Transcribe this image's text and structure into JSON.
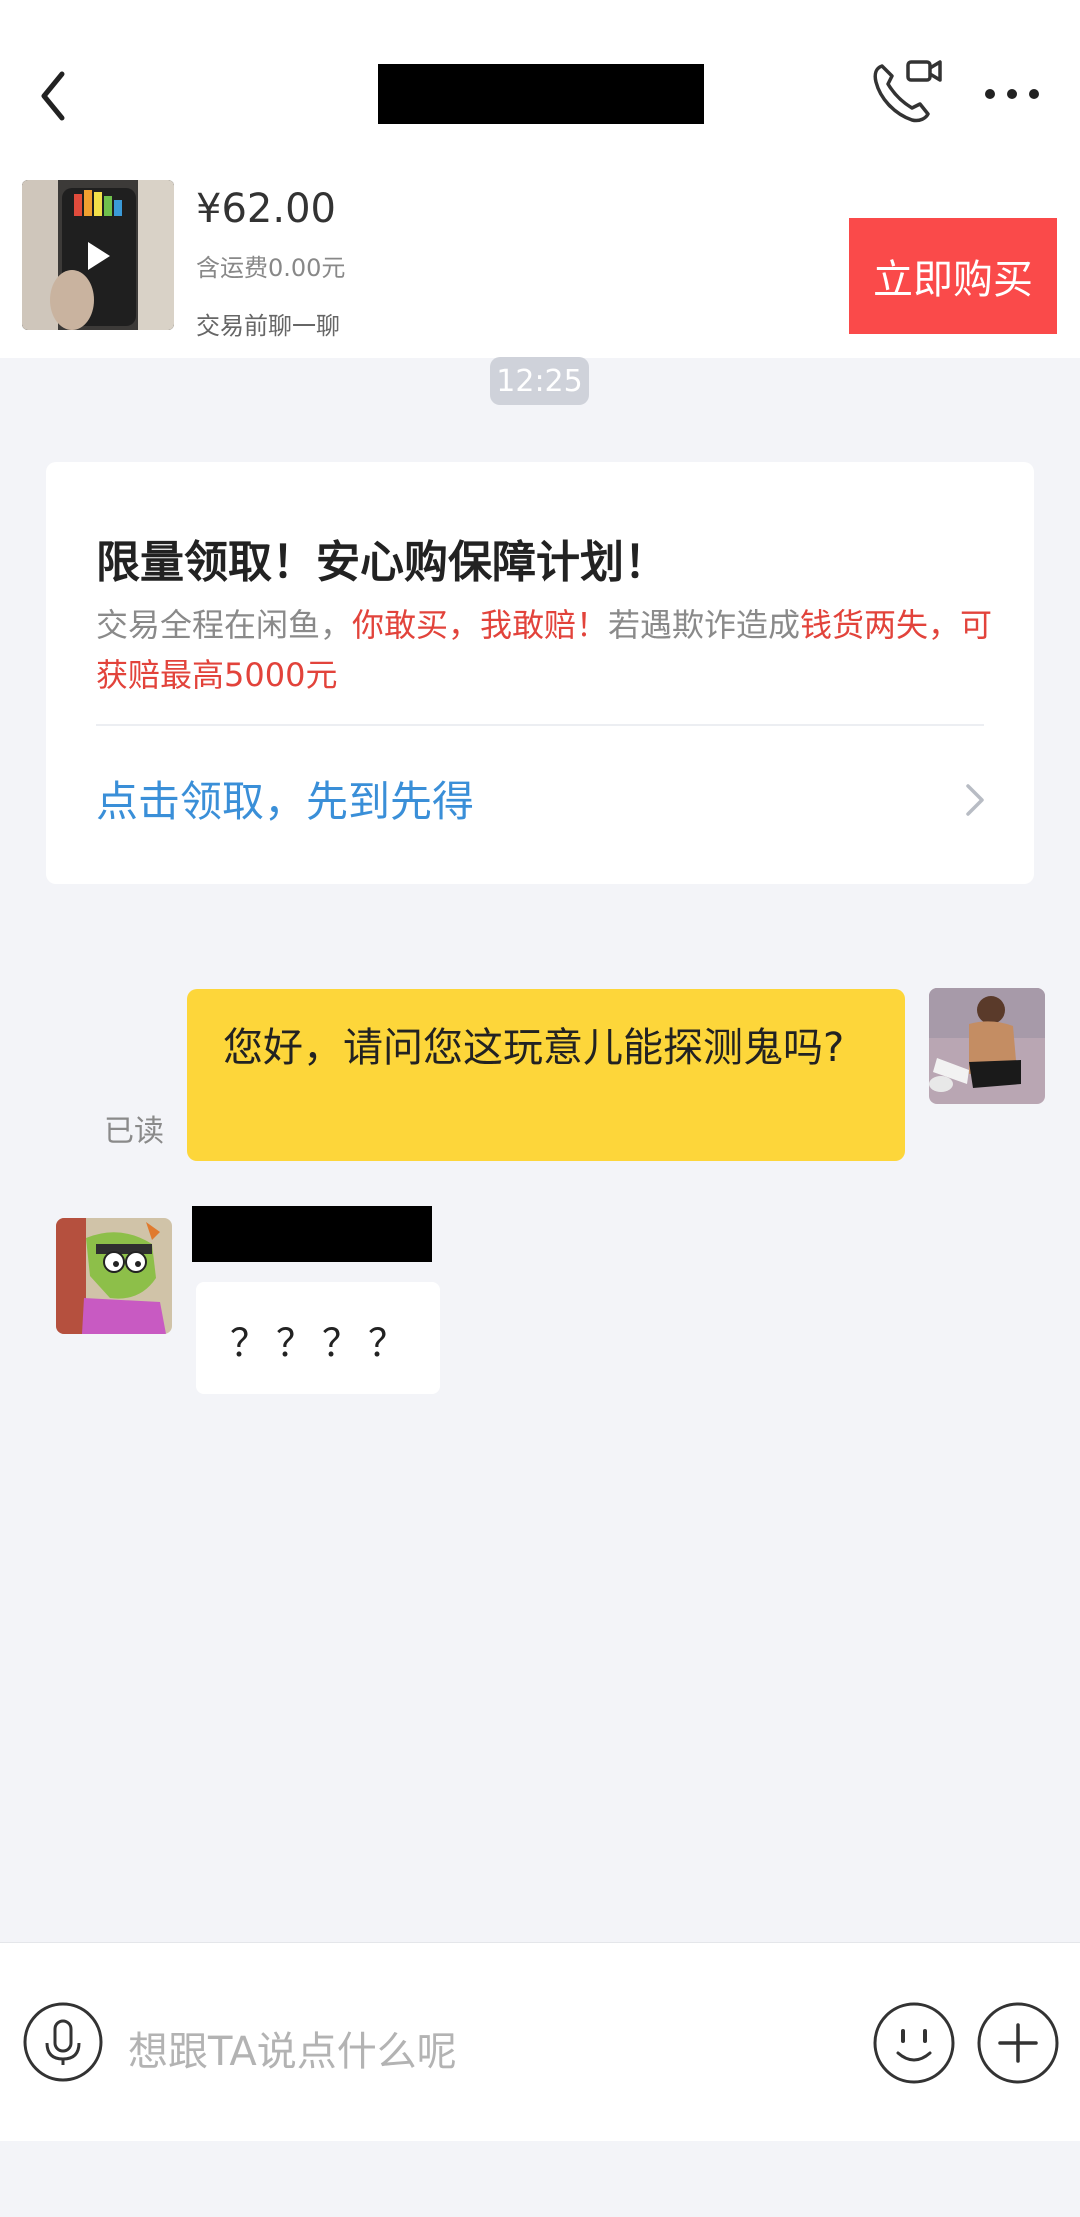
{
  "header": {
    "back_icon": "chevron-left-icon",
    "title_redacted": "",
    "call_icon": "phone-video-icon",
    "more_icon": "more-horizontal-icon"
  },
  "product": {
    "price": "¥62.00",
    "shipping": "含运费0.00元",
    "chat_note": "交易前聊一聊",
    "buy_label": "立即购买",
    "buy_color": "#fa4a4a"
  },
  "chat": {
    "time": "12:25",
    "card": {
      "title": "限量领取！安心购保障计划！",
      "body_part1": "交易全程在闲鱼，",
      "body_part2_red": "你敢买，我敢赔！",
      "body_part3": "若遇欺诈造成",
      "body_part4_red": "钱货两失，可获赔最高5000元",
      "claim_link": "点击领取，先到先得"
    },
    "outgoing": {
      "read_status": "已读",
      "text": "您好，请问您这玩意儿能探测鬼吗?"
    },
    "incoming": {
      "text": "？？？？"
    }
  },
  "input": {
    "placeholder": "想跟TA说点什么呢",
    "mic_icon": "microphone-icon",
    "emoji_icon": "smiley-icon",
    "plus_icon": "plus-circle-icon"
  }
}
